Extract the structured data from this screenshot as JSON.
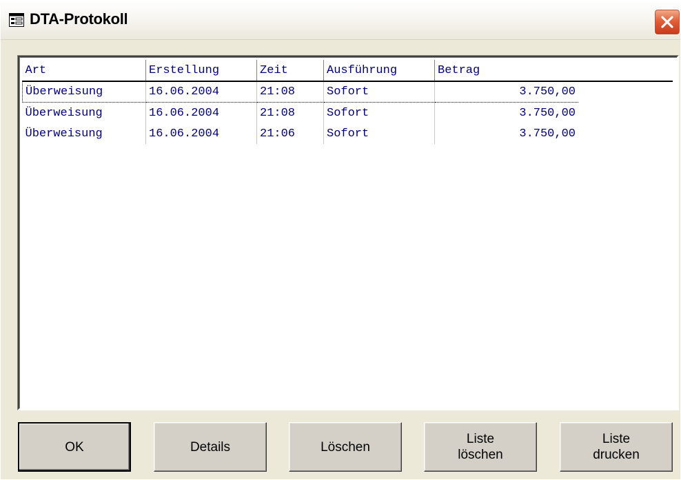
{
  "window": {
    "title": "DTA-Protokoll",
    "icon": "form-icon",
    "close_icon": "close-icon",
    "accent_close": "#d9512e"
  },
  "list": {
    "columns": [
      "Art",
      "Erstellung",
      "Zeit",
      "Ausführung",
      "Betrag"
    ],
    "rows": [
      {
        "art": "Überweisung",
        "erstellung": "16.06.2004",
        "zeit": "21:08",
        "ausfuehrung": "Sofort",
        "betrag": "3.750,00"
      },
      {
        "art": "Überweisung",
        "erstellung": "16.06.2004",
        "zeit": "21:08",
        "ausfuehrung": "Sofort",
        "betrag": "3.750,00"
      },
      {
        "art": "Überweisung",
        "erstellung": "16.06.2004",
        "zeit": "21:06",
        "ausfuehrung": "Sofort",
        "betrag": "3.750,00"
      }
    ],
    "text_color": "#000080"
  },
  "buttons": {
    "ok": "OK",
    "details": "Details",
    "loeschen": "Löschen",
    "liste_loeschen": "Liste\nlöschen",
    "liste_drucken": "Liste\ndrucken"
  }
}
